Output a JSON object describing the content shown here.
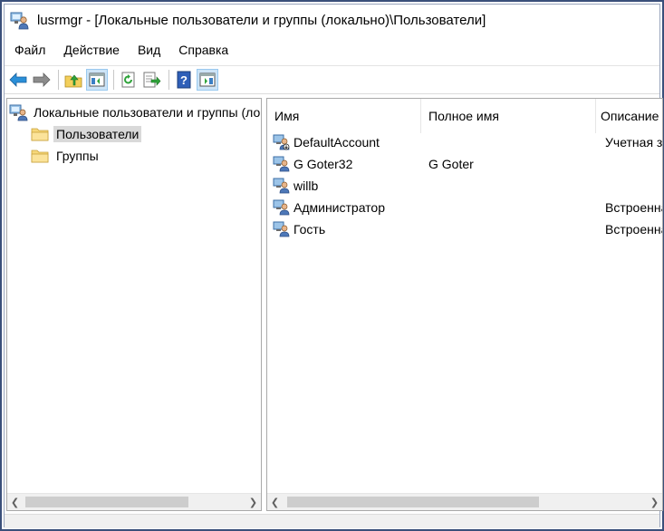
{
  "window": {
    "title": "lusrmgr - [Локальные пользователи и группы (локально)\\Пользователи]",
    "icon": "users-computer-icon"
  },
  "menu": [
    {
      "label": "Файл"
    },
    {
      "label": "Действие"
    },
    {
      "label": "Вид"
    },
    {
      "label": "Справка"
    }
  ],
  "toolbar": {
    "buttons": [
      "back-arrow-icon",
      "forward-arrow-icon",
      "up-folder-icon",
      "show-hide-tree-icon",
      "refresh-icon",
      "export-list-icon",
      "help-icon",
      "action-pane-icon"
    ]
  },
  "tree": {
    "root": "Локальные пользователи и группы (локально)",
    "items": [
      {
        "label": "Пользователи",
        "selected": true
      },
      {
        "label": "Группы",
        "selected": false
      }
    ]
  },
  "list": {
    "columns": [
      "Имя",
      "Полное имя",
      "Описание"
    ],
    "rows": [
      {
        "name": "DefaultAccount",
        "full_name": "",
        "description": "Учетная запись",
        "icon": "user-disabled-icon"
      },
      {
        "name": "G Goter32",
        "full_name": "G Goter",
        "description": "",
        "icon": "user-icon"
      },
      {
        "name": "willb",
        "full_name": "",
        "description": "",
        "icon": "user-icon"
      },
      {
        "name": "Администратор",
        "full_name": "",
        "description": "Встроенная",
        "icon": "user-icon"
      },
      {
        "name": "Гость",
        "full_name": "",
        "description": "Встроенная",
        "icon": "user-icon"
      }
    ]
  },
  "colors": {
    "selection": "#d9d9d9",
    "toolbar_pressed": "#cce4f7",
    "frame_border": "#3a4f7a"
  }
}
